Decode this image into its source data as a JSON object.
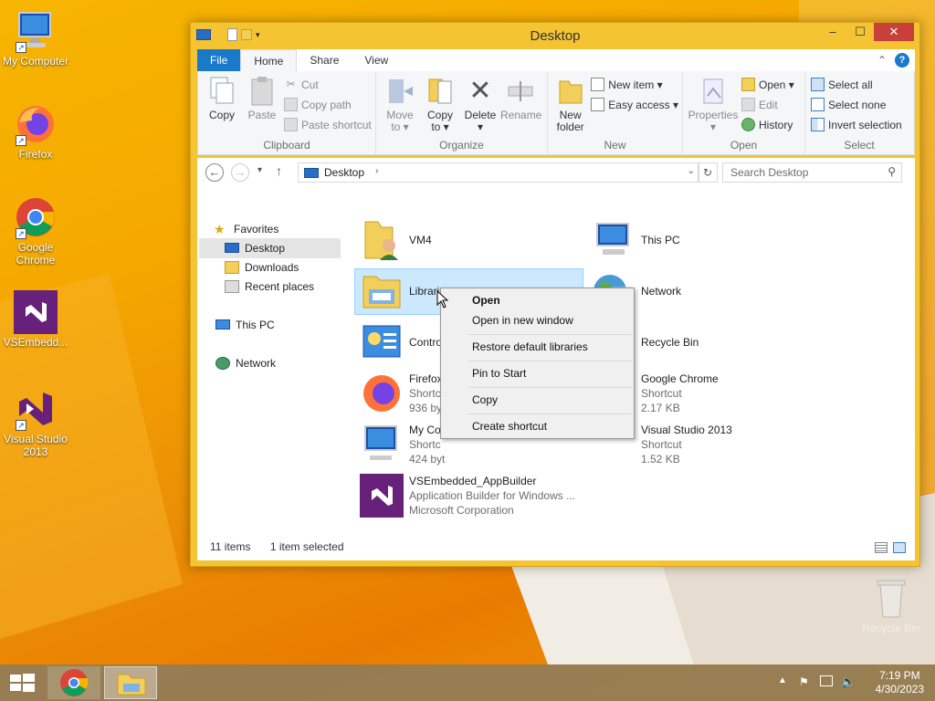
{
  "desktop": {
    "icons": [
      {
        "label": "My Computer"
      },
      {
        "label": "Firefox"
      },
      {
        "label": "Google Chrome"
      },
      {
        "label": "VSEmbedd..."
      },
      {
        "label": "Visual Studio 2013"
      }
    ],
    "recycle_bin": "Recycle Bin"
  },
  "window": {
    "title": "Desktop",
    "controls": {
      "minimize": "–",
      "maximize": "☐",
      "close": "✕"
    },
    "tabs": [
      {
        "label": "File"
      },
      {
        "label": "Home"
      },
      {
        "label": "Share"
      },
      {
        "label": "View"
      }
    ],
    "ribbon": {
      "clipboard": {
        "label": "Clipboard",
        "copy": "Copy",
        "paste": "Paste",
        "cut": "Cut",
        "copy_path": "Copy path",
        "paste_shortcut": "Paste shortcut"
      },
      "organize": {
        "label": "Organize",
        "move_to": "Move\nto ▾",
        "copy_to": "Copy\nto ▾",
        "delete": "Delete\n▾",
        "rename": "Rename"
      },
      "new": {
        "label": "New",
        "new_folder": "New\nfolder",
        "new_item": "New item ▾",
        "easy_access": "Easy access ▾"
      },
      "open": {
        "label": "Open",
        "properties": "Properties\n▾",
        "open": "Open ▾",
        "edit": "Edit",
        "history": "History"
      },
      "select": {
        "label": "Select",
        "select_all": "Select all",
        "select_none": "Select none",
        "invert": "Invert selection"
      }
    },
    "address": {
      "path": "Desktop",
      "search_placeholder": "Search Desktop"
    },
    "nav": {
      "favorites": "Favorites",
      "desktop": "Desktop",
      "downloads": "Downloads",
      "recent": "Recent places",
      "this_pc": "This PC",
      "network": "Network"
    },
    "items": {
      "vm4": {
        "name": "VM4"
      },
      "this_pc": {
        "name": "This PC"
      },
      "libraries": {
        "name": "Libraries"
      },
      "network": {
        "name": "Network"
      },
      "control": {
        "name": "Contro"
      },
      "recycle": {
        "name": "Recycle Bin"
      },
      "firefox": {
        "name": "Firefox",
        "type": "Shortc",
        "size": "936 byt"
      },
      "chrome": {
        "name": "Google Chrome",
        "type": "Shortcut",
        "size": "2.17 KB"
      },
      "mycomp": {
        "name": "My Co",
        "type": "Shortc",
        "size": "424 byt"
      },
      "vs2013": {
        "name": "Visual Studio 2013",
        "type": "Shortcut",
        "size": "1.52 KB"
      },
      "vsemb": {
        "name": "VSEmbedded_AppBuilder",
        "desc": "Application Builder for Windows ...",
        "company": "Microsoft Corporation"
      }
    },
    "status": {
      "count": "11 items",
      "selected": "1 item selected"
    }
  },
  "context_menu": {
    "open": "Open",
    "open_new": "Open in new window",
    "restore": "Restore default libraries",
    "pin": "Pin to Start",
    "copy": "Copy",
    "create_shortcut": "Create shortcut"
  },
  "taskbar": {
    "time": "7:19 PM",
    "date": "4/30/2023"
  }
}
